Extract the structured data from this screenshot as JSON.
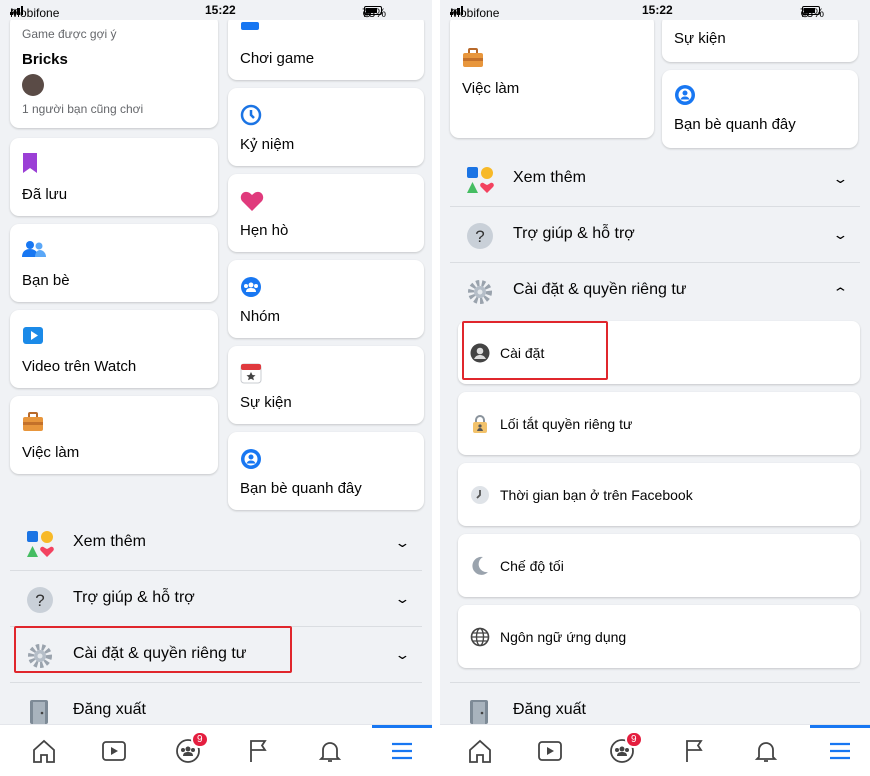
{
  "status_bar": {
    "carrier": "Mobifone",
    "time": "15:22",
    "battery": "78%"
  },
  "left": {
    "game_card": {
      "subtitle": "Game được gợi ý",
      "title": "Bricks",
      "friends": "1 người bạn cũng chơi"
    },
    "left_col": [
      {
        "label": "Đã lưu",
        "icon": "bookmark-icon"
      },
      {
        "label": "Bạn bè",
        "icon": "friends-icon"
      },
      {
        "label": "Video trên Watch",
        "icon": "watch-icon"
      },
      {
        "label": "Việc làm",
        "icon": "jobs-icon"
      }
    ],
    "right_col": [
      {
        "label": "Chơi game",
        "icon": "gaming-icon"
      },
      {
        "label": "Kỷ niệm",
        "icon": "memories-icon"
      },
      {
        "label": "Hẹn hò",
        "icon": "dating-icon"
      },
      {
        "label": "Nhóm",
        "icon": "groups-icon"
      },
      {
        "label": "Sự kiện",
        "icon": "events-icon"
      },
      {
        "label": "Bạn bè quanh đây",
        "icon": "nearby-friends-icon"
      }
    ],
    "rows": {
      "see_more": "Xem thêm",
      "help": "Trợ giúp & hỗ trợ",
      "settings": "Cài đặt & quyền riêng tư",
      "logout": "Đăng xuất"
    }
  },
  "right": {
    "cards": {
      "events": "Sự kiện",
      "jobs": "Việc làm",
      "nearby": "Bạn bè quanh đây"
    },
    "rows": {
      "see_more": "Xem thêm",
      "help": "Trợ giúp & hỗ trợ",
      "settings": "Cài đặt & quyền riêng tư",
      "logout": "Đăng xuất"
    },
    "settings_items": [
      {
        "label": "Cài đặt",
        "icon": "user-circle-icon"
      },
      {
        "label": "Lối tắt quyền riêng tư",
        "icon": "lock-icon"
      },
      {
        "label": "Thời gian bạn ở trên Facebook",
        "icon": "clock-icon"
      },
      {
        "label": "Chế độ tối",
        "icon": "moon-icon"
      },
      {
        "label": "Ngôn ngữ ứng dụng",
        "icon": "globe-icon"
      }
    ]
  },
  "tabbar": {
    "notifications_count": "9",
    "accent": "#1877f2"
  }
}
